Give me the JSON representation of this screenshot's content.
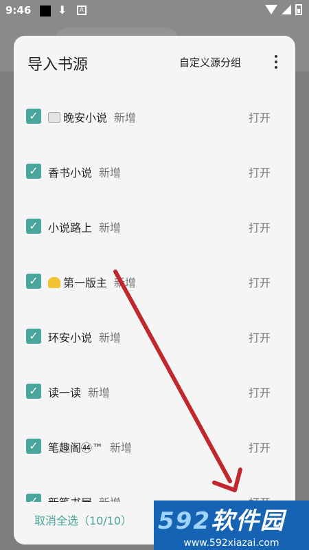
{
  "status_bar": {
    "time": "9:46",
    "icons": [
      "notification-square-icon",
      "download-icon",
      "a-box-icon",
      "wifi-icon",
      "signal-icon",
      "battery-icon"
    ]
  },
  "dialog": {
    "title": "导入书源",
    "group_button": "自定义源分组",
    "more_icon": "more-vertical-icon",
    "items": [
      {
        "name": "晚安小说",
        "tag": "新增",
        "action": "打开",
        "checked": true,
        "emoji": "newspaper-icon"
      },
      {
        "name": "香书小说",
        "tag": "新增",
        "action": "打开",
        "checked": true
      },
      {
        "name": "小说路上",
        "tag": "新增",
        "action": "打开",
        "checked": true
      },
      {
        "name": "第一版主",
        "tag": "新增",
        "action": "打开",
        "checked": true,
        "emoji": "taxi-icon"
      },
      {
        "name": "环安小说",
        "tag": "新增",
        "action": "打开",
        "checked": true
      },
      {
        "name": "读一读",
        "tag": "新增",
        "action": "打开",
        "checked": true
      },
      {
        "name": "笔趣阁㊹™",
        "tag": "新增",
        "action": "打开",
        "checked": true
      },
      {
        "name": "新笔书屋",
        "tag": "新增",
        "action": "打开",
        "checked": true
      }
    ],
    "footer_button": "取消全选（10/10）"
  },
  "watermark": {
    "brand_num": "592",
    "brand_text": "软件园",
    "url": "www.592xiazai.com"
  },
  "colors": {
    "accent": "#4aa59c",
    "arrow": "#c0282d",
    "watermark_bg": "#1763b3"
  }
}
